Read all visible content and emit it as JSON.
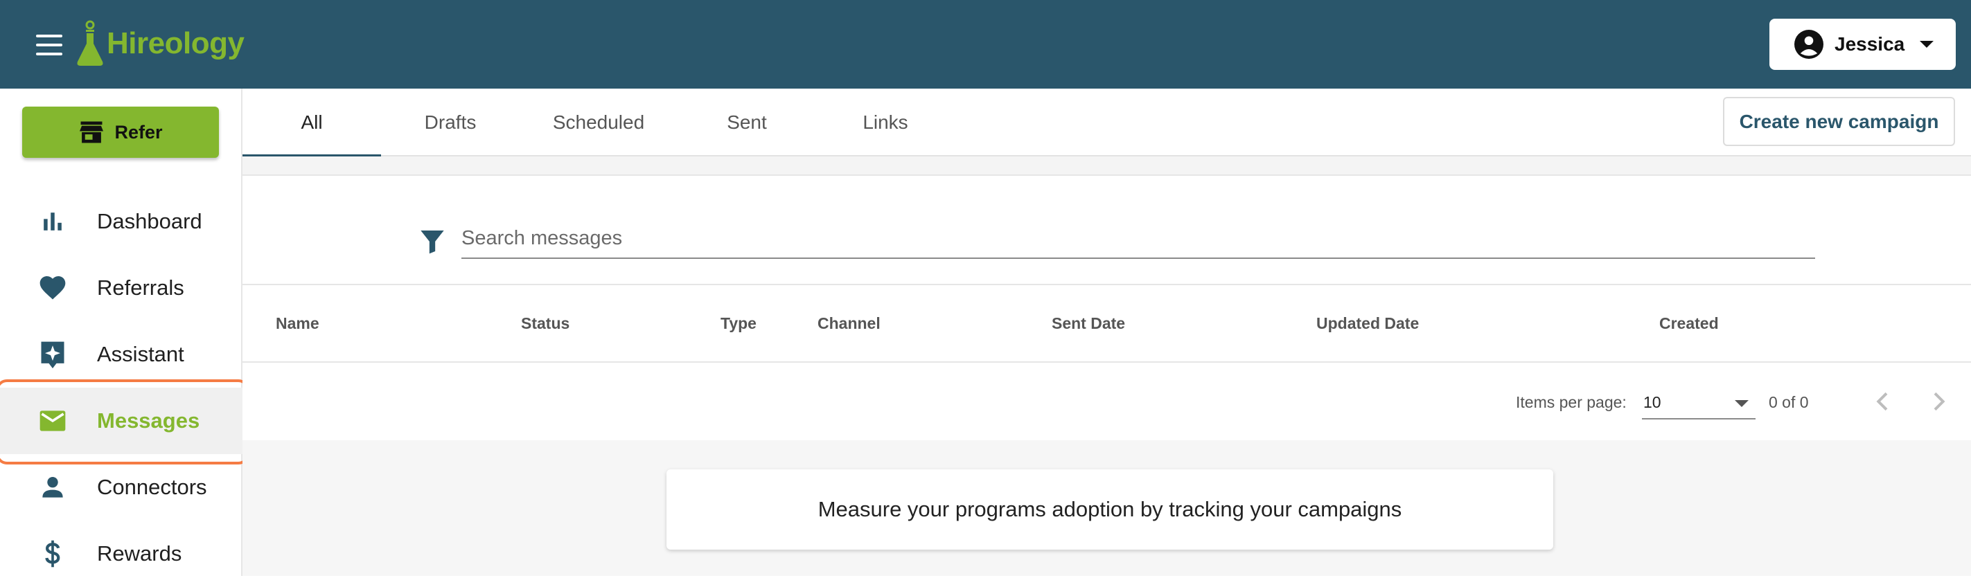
{
  "brand": {
    "name": "Hireology",
    "color": "#84b72f",
    "header_color": "#2a566b"
  },
  "user": {
    "name": "Jessica"
  },
  "sidebar": {
    "refer_label": "Refer",
    "items": [
      {
        "label": "Dashboard",
        "icon": "bar-chart-icon"
      },
      {
        "label": "Referrals",
        "icon": "heart-icon"
      },
      {
        "label": "Assistant",
        "icon": "sparkle-icon"
      },
      {
        "label": "Messages",
        "icon": "mail-icon",
        "active": true
      },
      {
        "label": "Connectors",
        "icon": "person-icon"
      },
      {
        "label": "Rewards",
        "icon": "dollar-icon"
      }
    ]
  },
  "tabs": [
    {
      "label": "All",
      "active": true
    },
    {
      "label": "Drafts"
    },
    {
      "label": "Scheduled"
    },
    {
      "label": "Sent"
    },
    {
      "label": "Links"
    }
  ],
  "create_campaign_label": "Create new campaign",
  "search": {
    "placeholder": "Search messages",
    "value": ""
  },
  "table": {
    "columns": [
      "Name",
      "Status",
      "Type",
      "Channel",
      "Sent Date",
      "Updated Date",
      "Created"
    ]
  },
  "pager": {
    "items_per_page_label": "Items per page:",
    "items_per_page": "10",
    "range": "0 of 0"
  },
  "info_message": "Measure your programs adoption by tracking your campaigns",
  "accent_highlight": "#f57c44"
}
